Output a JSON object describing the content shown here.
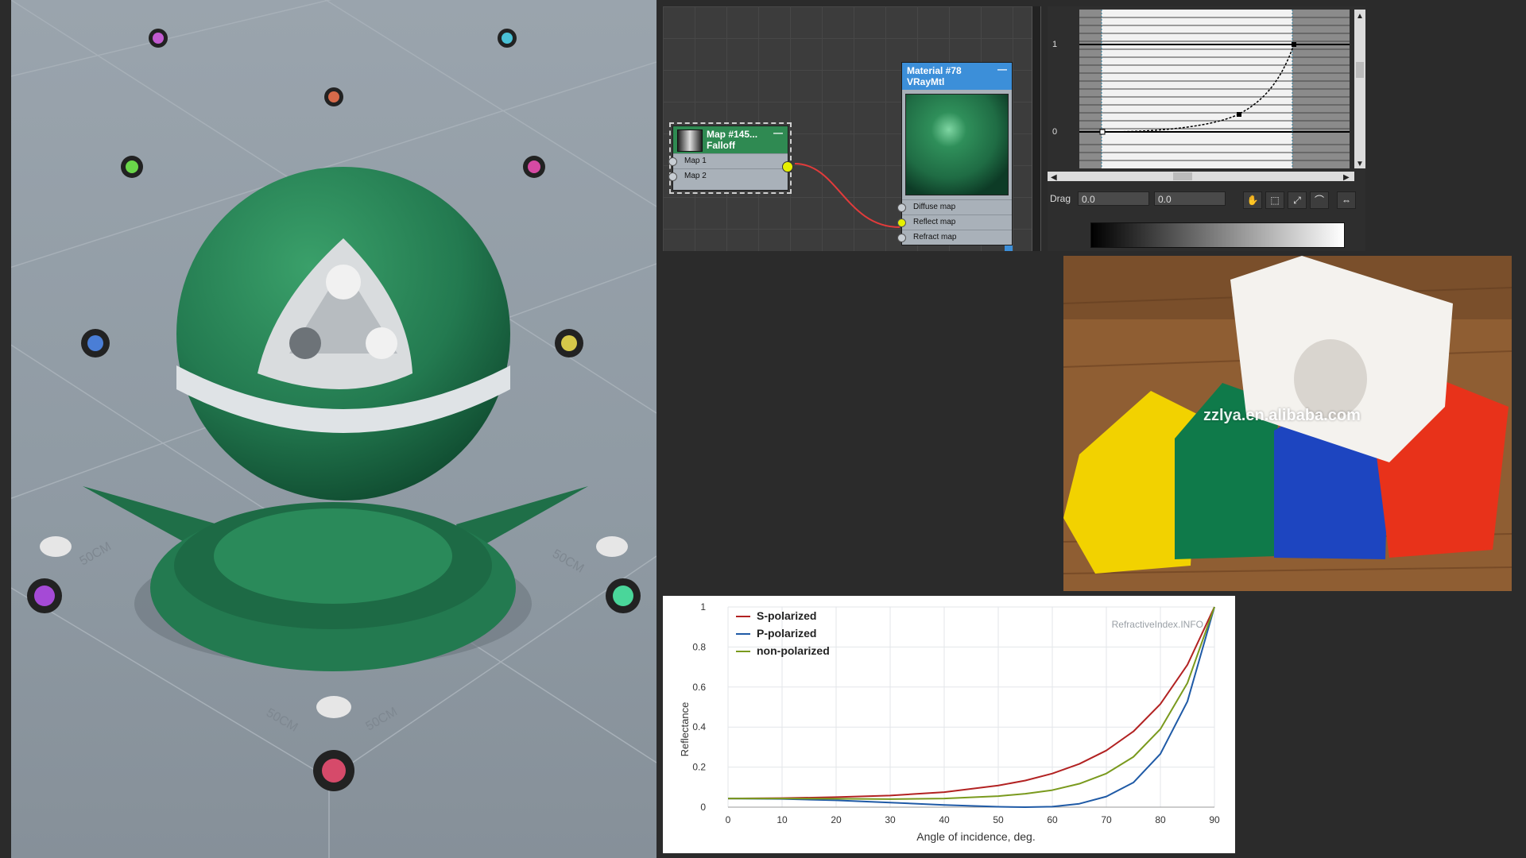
{
  "node_editor": {
    "falloff_node": {
      "title": "Map #145...",
      "subtitle": "Falloff",
      "collapse": "—",
      "slots": [
        "Map 1",
        "Map 2"
      ]
    },
    "material_node": {
      "title": "Material #78",
      "subtitle": "VRayMtl",
      "collapse": "—",
      "slots": [
        "Diffuse map",
        "Reflect map",
        "Refract map"
      ]
    }
  },
  "curve_editor": {
    "y_labels": [
      "1",
      "0"
    ],
    "drag_label": "Drag",
    "field_1": "0.0",
    "field_2": "0.0",
    "tools": [
      "✋",
      "⬚",
      "⤢",
      "⌒",
      "⇔"
    ]
  },
  "photo": {
    "watermark": "zzlya.en.alibaba.com",
    "block_colors": [
      "#f2d200",
      "#0f7a4a",
      "#1d45c0",
      "#e8321a",
      "#f4f2ee"
    ]
  },
  "render": {
    "floor_label": "50CM"
  },
  "chart_data": {
    "type": "line",
    "xlabel": "Angle of incidence, deg.",
    "ylabel": "Reflectance",
    "watermark": "RefractiveIndex.INFO",
    "xlim": [
      0,
      90
    ],
    "ylim": [
      0,
      1
    ],
    "x_ticks": [
      0,
      10,
      20,
      30,
      40,
      50,
      60,
      70,
      80,
      90
    ],
    "y_ticks": [
      0,
      0.2,
      0.4,
      0.6,
      0.8,
      1
    ],
    "y_tick_labels": [
      "0",
      "0.2",
      "0.4",
      "0.6",
      "0.8",
      "1"
    ],
    "legend_position": "top-left",
    "grid": true,
    "x": [
      0,
      10,
      20,
      30,
      40,
      50,
      55,
      60,
      65,
      70,
      75,
      80,
      85,
      90
    ],
    "series": [
      {
        "name": "S-polarized",
        "color": "#b22222",
        "values": [
          0.043,
          0.045,
          0.05,
          0.058,
          0.075,
          0.108,
          0.133,
          0.168,
          0.216,
          0.283,
          0.378,
          0.515,
          0.711,
          1.0
        ]
      },
      {
        "name": "P-polarized",
        "color": "#1f5aa6",
        "values": [
          0.043,
          0.041,
          0.034,
          0.023,
          0.011,
          0.0018,
          0.0,
          0.0025,
          0.017,
          0.053,
          0.123,
          0.266,
          0.528,
          1.0
        ]
      },
      {
        "name": "non-polarized",
        "color": "#7a9a1e",
        "values": [
          0.043,
          0.043,
          0.042,
          0.04,
          0.043,
          0.055,
          0.067,
          0.085,
          0.117,
          0.168,
          0.251,
          0.39,
          0.62,
          1.0
        ]
      }
    ]
  }
}
